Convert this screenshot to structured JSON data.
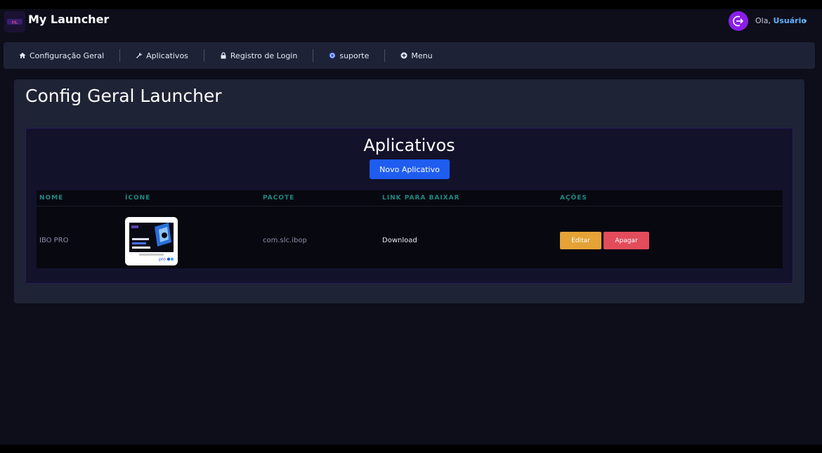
{
  "app": {
    "title": "My Launcher"
  },
  "user": {
    "greeting": "Ola,",
    "name": "Usuário"
  },
  "nav": {
    "items": [
      {
        "label": "Configuração Geral",
        "icon": "home-icon"
      },
      {
        "label": "Aplicativos",
        "icon": "wrench-icon"
      },
      {
        "label": "Registro de Login",
        "icon": "lock-icon"
      },
      {
        "label": "suporte",
        "icon": "whatsapp-icon"
      },
      {
        "label": "Menu",
        "icon": "plus-circle-icon"
      }
    ]
  },
  "page": {
    "title": "Config Geral Launcher"
  },
  "apps_panel": {
    "title": "Aplicativos",
    "new_button": "Novo Aplicativo",
    "columns": [
      "NOME",
      "ÍCONE",
      "PACOTE",
      "LINK PARA BAIXAR",
      "AÇÕES"
    ],
    "rows": [
      {
        "name": "IBO PRO",
        "package": "com.slc.ibop",
        "link": "Download",
        "edit": "Editar",
        "delete": "Apagar"
      }
    ]
  },
  "colors": {
    "background": "#0d0e1a",
    "nav": "#1d2237",
    "primary": "#1f5cf0",
    "edit": "#e5a236",
    "delete": "#e24c5b",
    "header_text": "#1f8a82",
    "user_name": "#5fb4ff",
    "avatar": "#8a1fe8"
  }
}
